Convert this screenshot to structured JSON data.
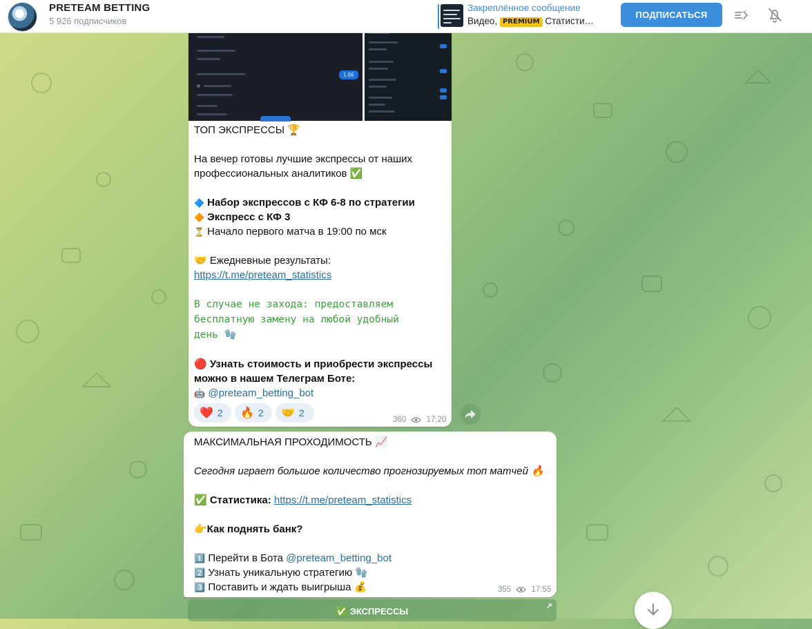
{
  "header": {
    "channel_name": "PRETEAM BETTING",
    "subscribers": "5 926 подписчиков",
    "pinned_title": "Закреплённое сообщение",
    "pinned_prefix": "Видео, ",
    "pinned_badge": "PREMIUM",
    "pinned_suffix": " Статисти…",
    "subscribe_label": "ПОДПИСАТЬСЯ",
    "accent_color": "#3a8edb"
  },
  "message1": {
    "media_odds_chip": "1.66",
    "title": "ТОП ЭКСПРЕССЫ 🏆",
    "intro_line1": "На вечер готовы лучшие экспрессы от наших",
    "intro_line2": "профессиональных аналитиков ✅",
    "item1_icon": "🔷",
    "item1": "Набор экспрессов с КФ 6-8 по стратегии",
    "item2_icon": "🔶",
    "item2": "Экспресс с КФ 3",
    "item3_icon": "⏳",
    "item3": "Начало первого матча в 19:00 по мск",
    "results_label": "🤝 Ежедневные результаты:",
    "results_link": "https://t.me/preteam_statistics",
    "guarantee_line1": "В случае не захода: предоставляем",
    "guarantee_line2": "бесплатную замену на любой удобный",
    "guarantee_line3": "день 🧤",
    "cta_line1": "🔴 Узнать стоимость и приобрести экспрессы",
    "cta_line2": "можно в нашем Телеграм Боте:",
    "bot_icon": "🤖",
    "bot_mention": "@preteam_betting_bot",
    "reactions": [
      {
        "emoji": "❤️",
        "count": "2"
      },
      {
        "emoji": "🔥",
        "count": "2"
      },
      {
        "emoji": "🤝",
        "count": "2"
      }
    ],
    "views": "360",
    "time": "17:20"
  },
  "message2": {
    "title": "МАКСИМАЛЬНАЯ ПРОХОДИМОСТЬ 📈",
    "subtitle": "Сегодня играет большое количество прогнозируемых топ матчей 🔥",
    "stats_label": "✅ Статистика:",
    "stats_link": "https://t.me/preteam_statistics",
    "question": "👉Как поднять банк?",
    "step1_num": "1️⃣",
    "step1": "Перейти в Бота ",
    "step1_mention": "@preteam_betting_bot",
    "step2_num": "2️⃣",
    "step2": "Узнать уникальную стратегию 🧤",
    "step3_num": "3️⃣",
    "step3": "Поставить и ждать выигрыша 💰",
    "views": "355",
    "time": "17:55"
  },
  "inline_button": {
    "label": "✅ ЭКСПРЕССЫ",
    "corner": "↗"
  }
}
